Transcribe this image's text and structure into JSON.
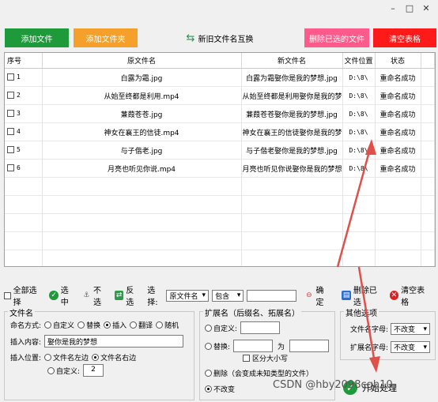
{
  "window": {
    "controls": [
      "–",
      "□",
      "✕"
    ]
  },
  "toolbar": {
    "add_files": "添加文件",
    "add_folder": "添加文件夹",
    "swap_names": "新旧文件名互换",
    "delete_selected": "删除已选的文件",
    "clear_table": "清空表格"
  },
  "table": {
    "headers": [
      "序号",
      "原文件名",
      "新文件名",
      "文件位置",
      "状态"
    ],
    "rows": [
      {
        "num": "1",
        "orig": "白露为霜.jpg",
        "new": "白露为霜娶你是我的梦想.jpg",
        "loc": "D:\\8\\",
        "status": "重命名成功"
      },
      {
        "num": "2",
        "orig": "从始至终都是利用.mp4",
        "new": "从始至终都是利用娶你是我的梦想.mp4",
        "loc": "D:\\8\\",
        "status": "重命名成功"
      },
      {
        "num": "3",
        "orig": "蒹葭苍苍.jpg",
        "new": "蒹葭苍苍娶你是我的梦想.jpg",
        "loc": "D:\\8\\",
        "status": "重命名成功"
      },
      {
        "num": "4",
        "orig": "神女在襄王的信徒.mp4",
        "new": "神女在襄王的信徒娶你是我的梦想.mp4",
        "loc": "D:\\8\\",
        "status": "重命名成功"
      },
      {
        "num": "5",
        "orig": "与子偕老.jpg",
        "new": "与子偕老娶你是我的梦想.jpg",
        "loc": "D:\\8\\",
        "status": "重命名成功"
      },
      {
        "num": "6",
        "orig": "月亮也听见你说.mp4",
        "new": "月亮也听见你说娶你是我的梦想.mp4",
        "loc": "D:\\8\\",
        "status": "重命名成功"
      }
    ]
  },
  "actions": {
    "select_all": "全部选择",
    "select": "选中",
    "deselect": "不选",
    "invert": "反选",
    "choose_label": "选择:",
    "field_select": "原文件名",
    "match_select": "包含",
    "confirm": "确定",
    "delete_selected": "删除已选",
    "clear_table": "清空表格"
  },
  "filename_group": {
    "title": "文件名",
    "mode_label": "命名方式:",
    "modes": [
      "自定义",
      "替换",
      "插入",
      "翻译",
      "随机"
    ],
    "content_label": "插入内容:",
    "content_value": "娶你是我的梦想",
    "position_label": "插入位置:",
    "pos_left": "文件名左边",
    "pos_right": "文件名右边",
    "pos_custom": "自定义:",
    "pos_custom_value": "2"
  },
  "ext_group": {
    "title": "扩展名（后缀名、拓展名）",
    "custom": "自定义:",
    "replace": "替换:",
    "replace_as": "为",
    "case_sensitive": "区分大小写",
    "delete": "删除（会变成未知类型的文件）",
    "keep": "不改变"
  },
  "other_group": {
    "title": "其他选项",
    "filename_case_label": "文件名字母:",
    "filename_case_value": "不改变",
    "ext_case_label": "扩展名字母:",
    "ext_case_value": "不改变",
    "start_label": "开始处理"
  },
  "watermark": "CSDN @hby2098cgh10",
  "colors": {
    "green": "#1f9a3a",
    "orange": "#f5a02a",
    "pink": "#ff5a8c",
    "red": "#ff1a1a",
    "arrow": "#e0504a"
  }
}
